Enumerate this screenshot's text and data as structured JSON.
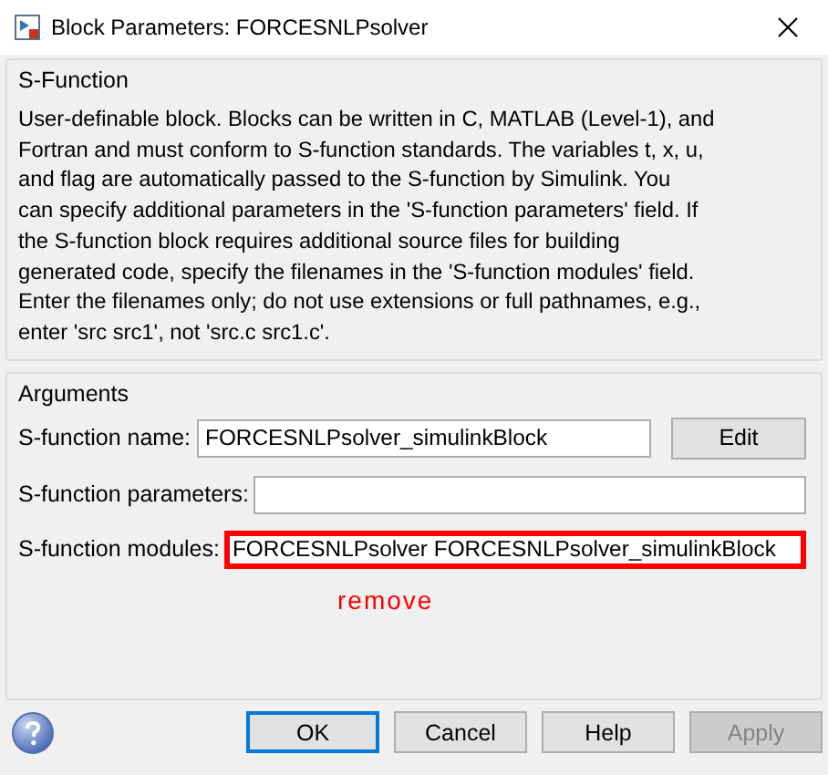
{
  "window": {
    "title": "Block Parameters: FORCESNLPsolver"
  },
  "description_group": {
    "title": "S-Function",
    "text": "User-definable block.  Blocks can be written in C, MATLAB (Level-1), and\nFortran and must conform to S-function standards.  The variables t, x, u,\nand flag are automatically passed to the S-function by Simulink.  You\ncan specify additional parameters in the 'S-function parameters' field. If\nthe S-function block requires additional source files for building\ngenerated code, specify the filenames in the 'S-function modules' field.\nEnter the filenames only; do not use extensions or full pathnames, e.g.,\nenter 'src src1', not 'src.c src1.c'."
  },
  "arguments_group": {
    "title": "Arguments",
    "fields": [
      {
        "label": "S-function name:",
        "value": "FORCESNLPsolver_simulinkBlock",
        "button": "Edit",
        "highlighted": false
      },
      {
        "label": "S-function parameters:",
        "highlighted": false
      },
      {
        "label": "S-function modules:",
        "value": "FORCESNLPsolver FORCESNLPsolver_simulinkBlock",
        "highlighted": true
      }
    ],
    "annotation": "remove"
  },
  "buttons": [
    {
      "label": "OK",
      "default": true,
      "disabled": false
    },
    {
      "label": "Cancel",
      "default": false,
      "disabled": false
    },
    {
      "label": "Help",
      "default": false,
      "disabled": false
    },
    {
      "label": "Apply",
      "default": false,
      "disabled": true
    }
  ]
}
